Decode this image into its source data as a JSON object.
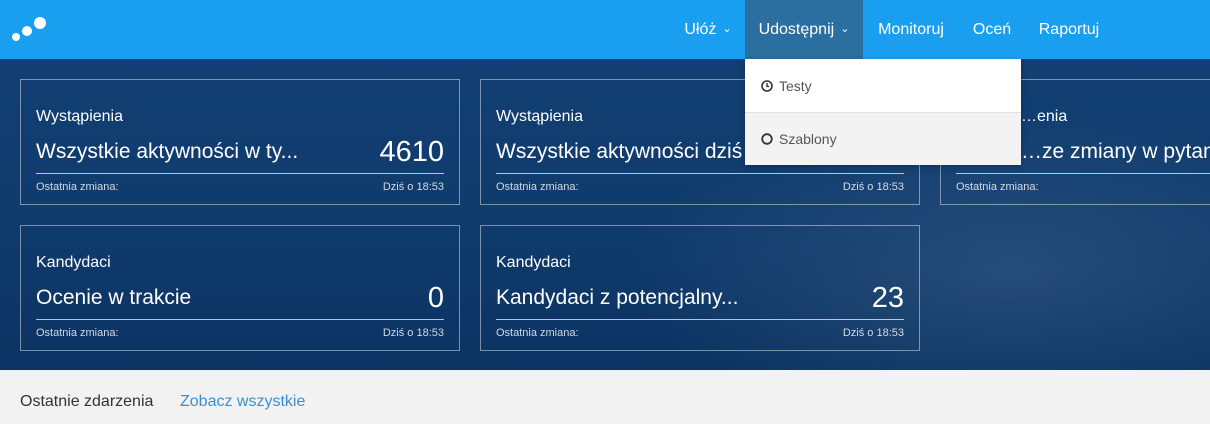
{
  "nav": {
    "items": [
      {
        "label": "Ułóż",
        "has_caret": true
      },
      {
        "label": "Udostępnij",
        "has_caret": true,
        "active": true
      },
      {
        "label": "Monitoruj"
      },
      {
        "label": "Oceń"
      },
      {
        "label": "Raportuj"
      }
    ],
    "caret": "⌄"
  },
  "dropdown": {
    "items": [
      {
        "label": "Testy",
        "icon": "clock-icon"
      },
      {
        "label": "Szablony",
        "icon": "circle-icon"
      }
    ]
  },
  "cards": [
    {
      "category": "Wystąpienia",
      "title": "Wszystkie aktywności w ty...",
      "value": "4610",
      "footer_label": "Ostatnia zmiana:",
      "footer_time": "Dziś o 18:53"
    },
    {
      "category": "Wystąpienia",
      "title": "Wszystkie aktywności dziś",
      "value": "",
      "footer_label": "Ostatnia zmiana:",
      "footer_time": "Dziś o 18:53"
    },
    {
      "category": "…enia",
      "title": "…ze zmiany w pytan...",
      "value": "",
      "footer_label": "Ostatnia zmiana:",
      "footer_time": ""
    },
    {
      "category": "Kandydaci",
      "title": "Ocenie w trakcie",
      "value": "0",
      "footer_label": "Ostatnia zmiana:",
      "footer_time": "Dziś o 18:53"
    },
    {
      "category": "Kandydaci",
      "title": "Kandydaci z potencjalny...",
      "value": "23",
      "footer_label": "Ostatnia zmiana:",
      "footer_time": "Dziś o 18:53"
    }
  ],
  "recent": {
    "title": "Ostatnie zdarzenia",
    "link": "Zobacz wszystkie"
  },
  "colors": {
    "topbar": "#1a9ff0",
    "active_nav": "#2a6fa0",
    "hero": "#0f3a6c",
    "link": "#3b8fd0"
  }
}
